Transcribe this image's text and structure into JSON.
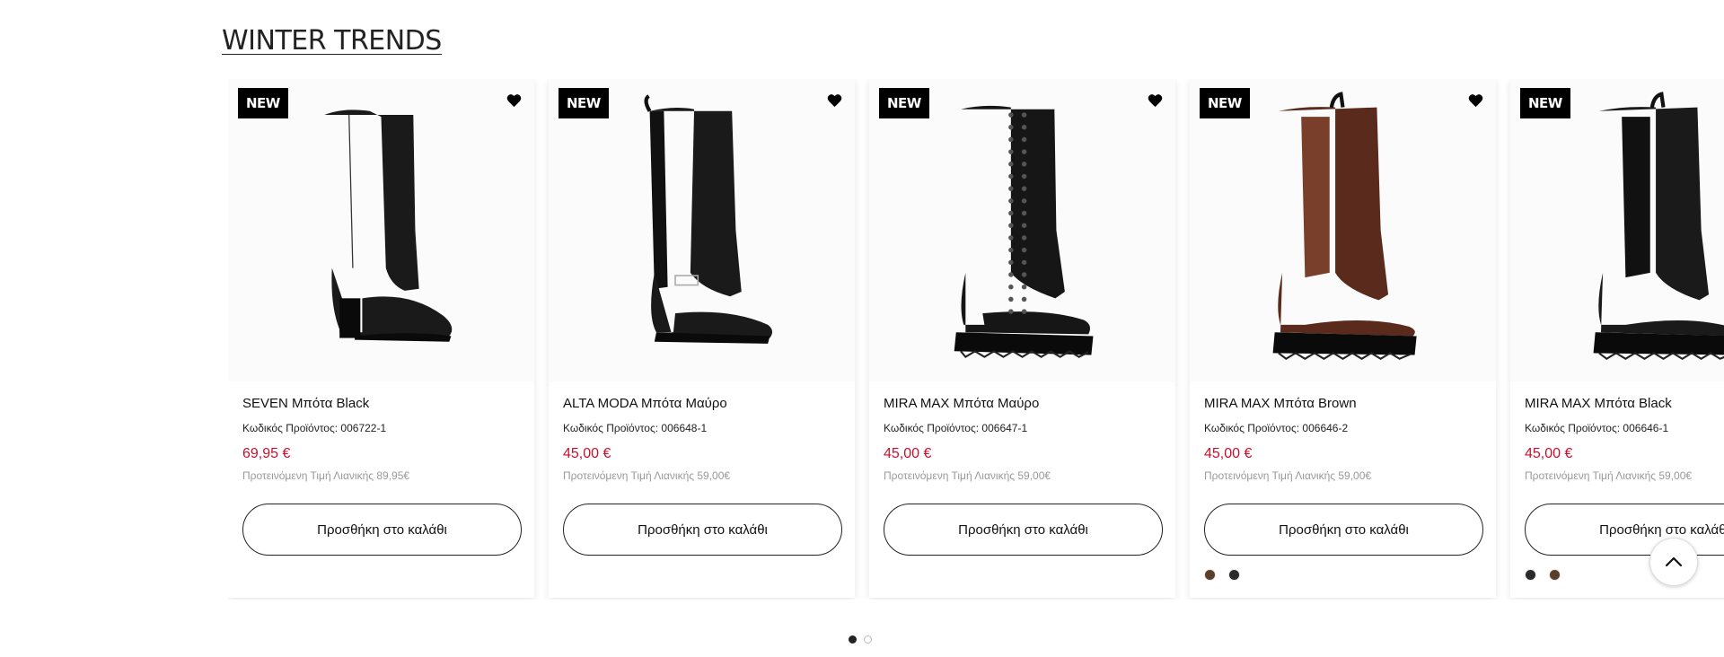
{
  "section": {
    "title": "WINTER TRENDS"
  },
  "colors": {
    "price": "#c8102e",
    "badge_bg": "#000000",
    "brown_swatch": "#5a3e29",
    "black_swatch": "#2a2a2a"
  },
  "products": [
    {
      "badge": "NEW",
      "name": "SEVEN Μπότα Black",
      "code": "Κωδικός Προϊόντος: 006722-1",
      "price": "69,95 €",
      "rrp": "Προτεινόμενη Τιμή Λιανικής 89,95€",
      "cart_label": "Προσθήκη στο καλάθι",
      "boot_color": "#1a1a1a",
      "boot_style": "heel",
      "swatches": []
    },
    {
      "badge": "NEW",
      "name": "ALTA  MODA Μπότα Μαύρο",
      "code": "Κωδικός Προϊόντος: 006648-1",
      "price": "45,00 €",
      "rrp": "Προτεινόμενη Τιμή Λιανικής 59,00€",
      "cart_label": "Προσθήκη στο καλάθι",
      "boot_color": "#1a1a1a",
      "boot_style": "buckle",
      "swatches": []
    },
    {
      "badge": "NEW",
      "name": "MIRA  MAX Μπότα Μαύρο",
      "code": "Κωδικός Προϊόντος: 006647-1",
      "price": "45,00 €",
      "rrp": "Προτεινόμενη Τιμή Λιανικής 59,00€",
      "cart_label": "Προσθήκη στο καλάθι",
      "boot_color": "#161616",
      "boot_style": "lace",
      "swatches": []
    },
    {
      "badge": "NEW",
      "name": "MIRA  MAX Μπότα Brown",
      "code": "Κωδικός Προϊόντος: 006646-2",
      "price": "45,00 €",
      "rrp": "Προτεινόμενη Τιμή Λιανικής 59,00€",
      "cart_label": "Προσθήκη στο καλάθι",
      "boot_color": "#5a2a1c",
      "boot_style": "chelsea",
      "swatches": [
        "#5a3e29",
        "#2a2a2a"
      ]
    },
    {
      "badge": "NEW",
      "name": "MIRA  MAX Μπότα Black",
      "code": "Κωδικός Προϊόντος: 006646-1",
      "price": "45,00 €",
      "rrp": "Προτεινόμενη Τιμή Λιανικής 59,00€",
      "cart_label": "Προσθήκη στο καλάθι",
      "boot_color": "#1a1a1a",
      "boot_style": "chelsea",
      "swatches": [
        "#2a2a2a",
        "#5a3e29"
      ]
    }
  ],
  "pagination": {
    "pages": 2,
    "active": 0
  },
  "icons": {
    "wishlist": "heart-icon",
    "back_to_top": "chevron-up-icon"
  }
}
